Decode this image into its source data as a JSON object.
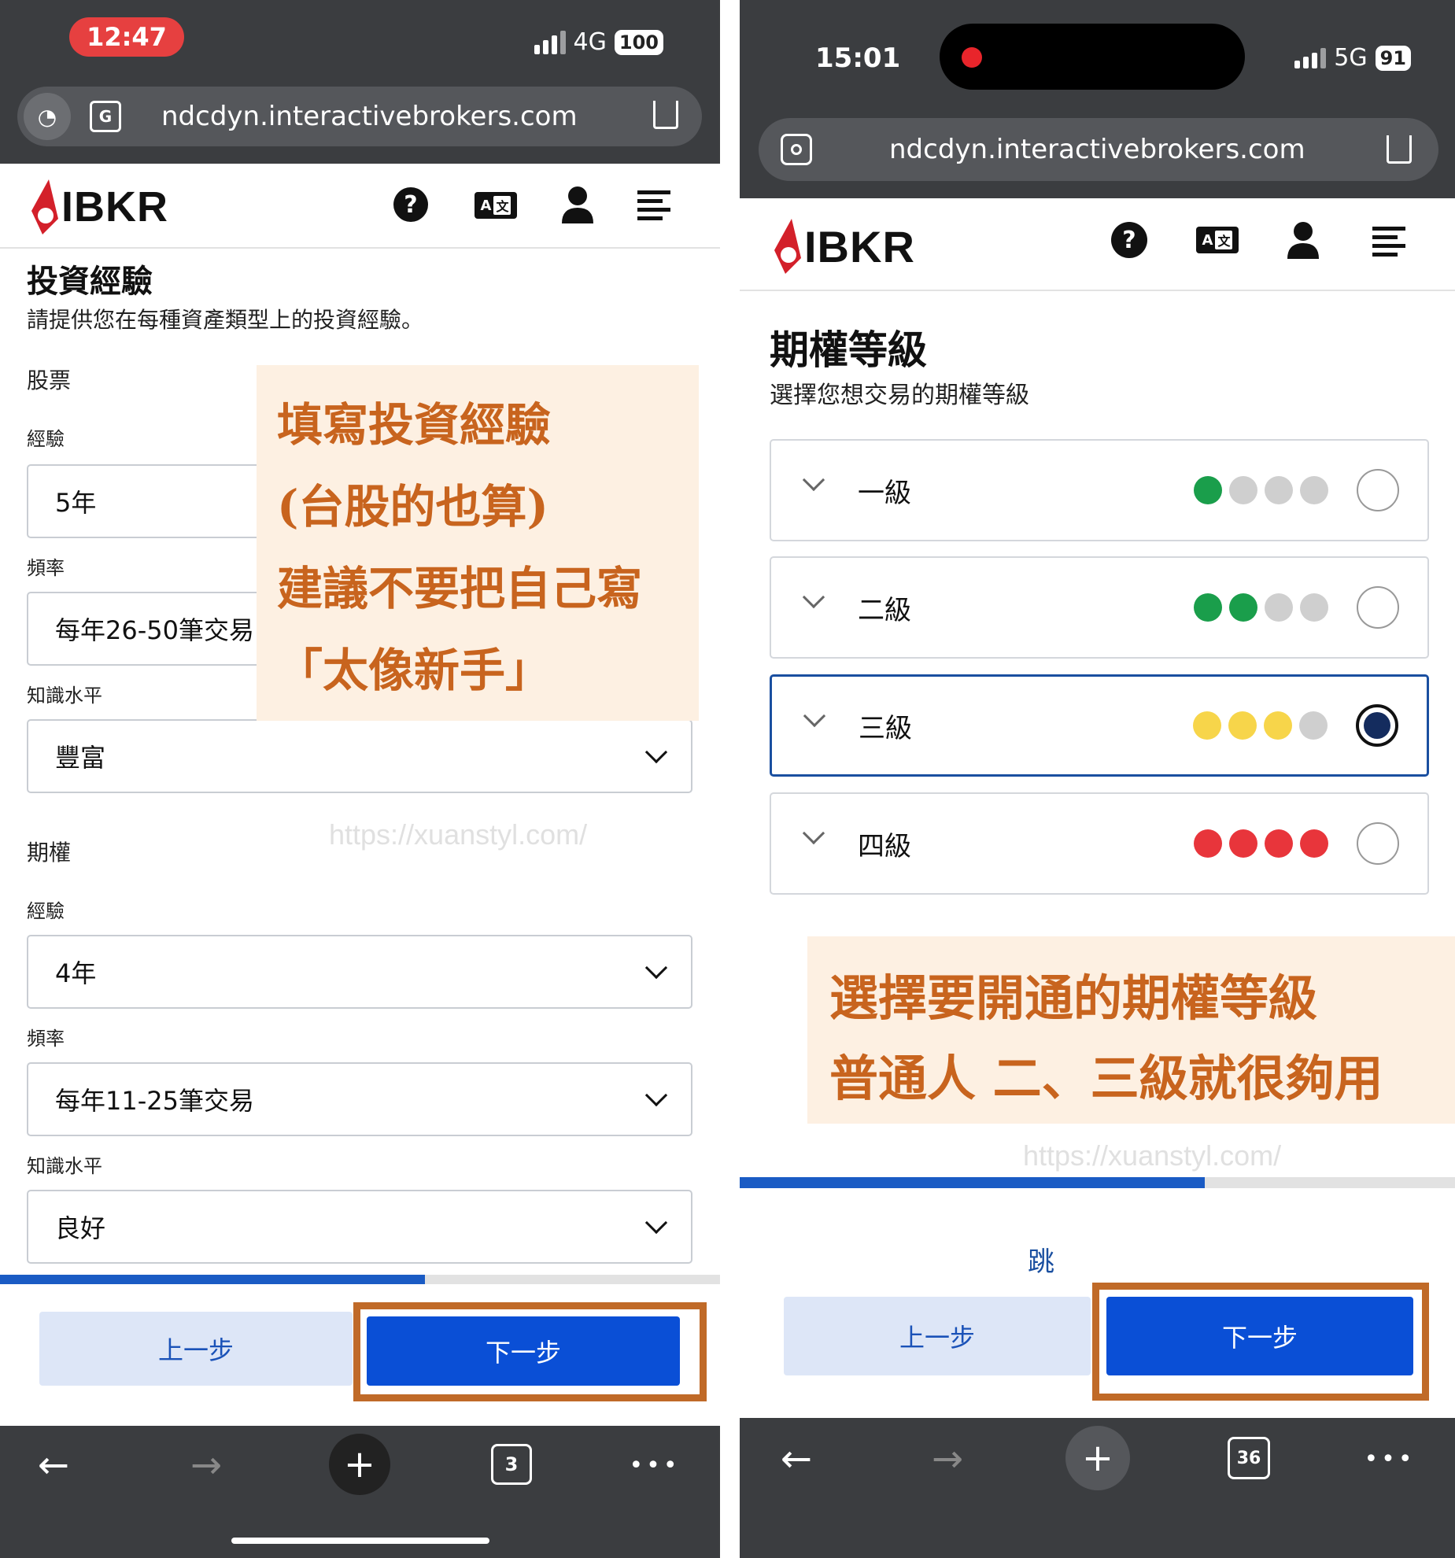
{
  "left": {
    "status": {
      "time": "12:47",
      "network": "4G",
      "battery": "100"
    },
    "url": "ndcdyn.interactivebrokers.com",
    "logo": "IBKR",
    "help_icon_text": "?",
    "title": "投資經驗",
    "subtitle": "請提供您在每種資產類型上的投資經驗。",
    "stocks": {
      "section": "股票",
      "experience_label": "經驗",
      "experience_value": "5年",
      "frequency_label": "頻率",
      "frequency_value": "每年26-50筆交易",
      "knowledge_label": "知識水平",
      "knowledge_value": "豐富"
    },
    "options": {
      "section": "期權",
      "experience_label": "經驗",
      "experience_value": "4年",
      "frequency_label": "頻率",
      "frequency_value": "每年11-25筆交易",
      "knowledge_label": "知識水平",
      "knowledge_value": "良好"
    },
    "note_lines": [
      "填寫投資經驗",
      "(台股的也算)",
      "建議不要把自己寫",
      "「太像新手」"
    ],
    "watermark": "https://xuanstyl.com/",
    "progress": 0.59,
    "prev_button": "上一步",
    "next_button": "下一步",
    "tabs_count": "3"
  },
  "right": {
    "status": {
      "time": "15:01",
      "network": "5G",
      "battery": "91"
    },
    "url": "ndcdyn.interactivebrokers.com",
    "logo": "IBKR",
    "help_icon_text": "?",
    "title": "期權等級",
    "subtitle": "選擇您想交易的期權等級",
    "levels": [
      {
        "label": "一級",
        "dots": [
          "#1a9e4b",
          "#cfcfcf",
          "#cfcfcf",
          "#cfcfcf"
        ],
        "selected": false
      },
      {
        "label": "二級",
        "dots": [
          "#1a9e4b",
          "#1a9e4b",
          "#cfcfcf",
          "#cfcfcf"
        ],
        "selected": false
      },
      {
        "label": "三級",
        "dots": [
          "#f7d54a",
          "#f7d54a",
          "#f7d54a",
          "#cfcfcf"
        ],
        "selected": true
      },
      {
        "label": "四級",
        "dots": [
          "#e8353b",
          "#e8353b",
          "#e8353b",
          "#e8353b"
        ],
        "selected": false
      }
    ],
    "note_lines": [
      "選擇要開通的期權等級",
      "普通人 二、三級就很夠用"
    ],
    "watermark": "https://xuanstyl.com/",
    "progress": 0.65,
    "skip_text": "跳",
    "prev_button": "上一步",
    "next_button": "下一步",
    "tabs_count": "36"
  },
  "colors": {
    "accent": "#0a4fd6",
    "highlight": "#c06a28",
    "note_text": "#c8641e",
    "note_bg": "#fdf0e2"
  }
}
